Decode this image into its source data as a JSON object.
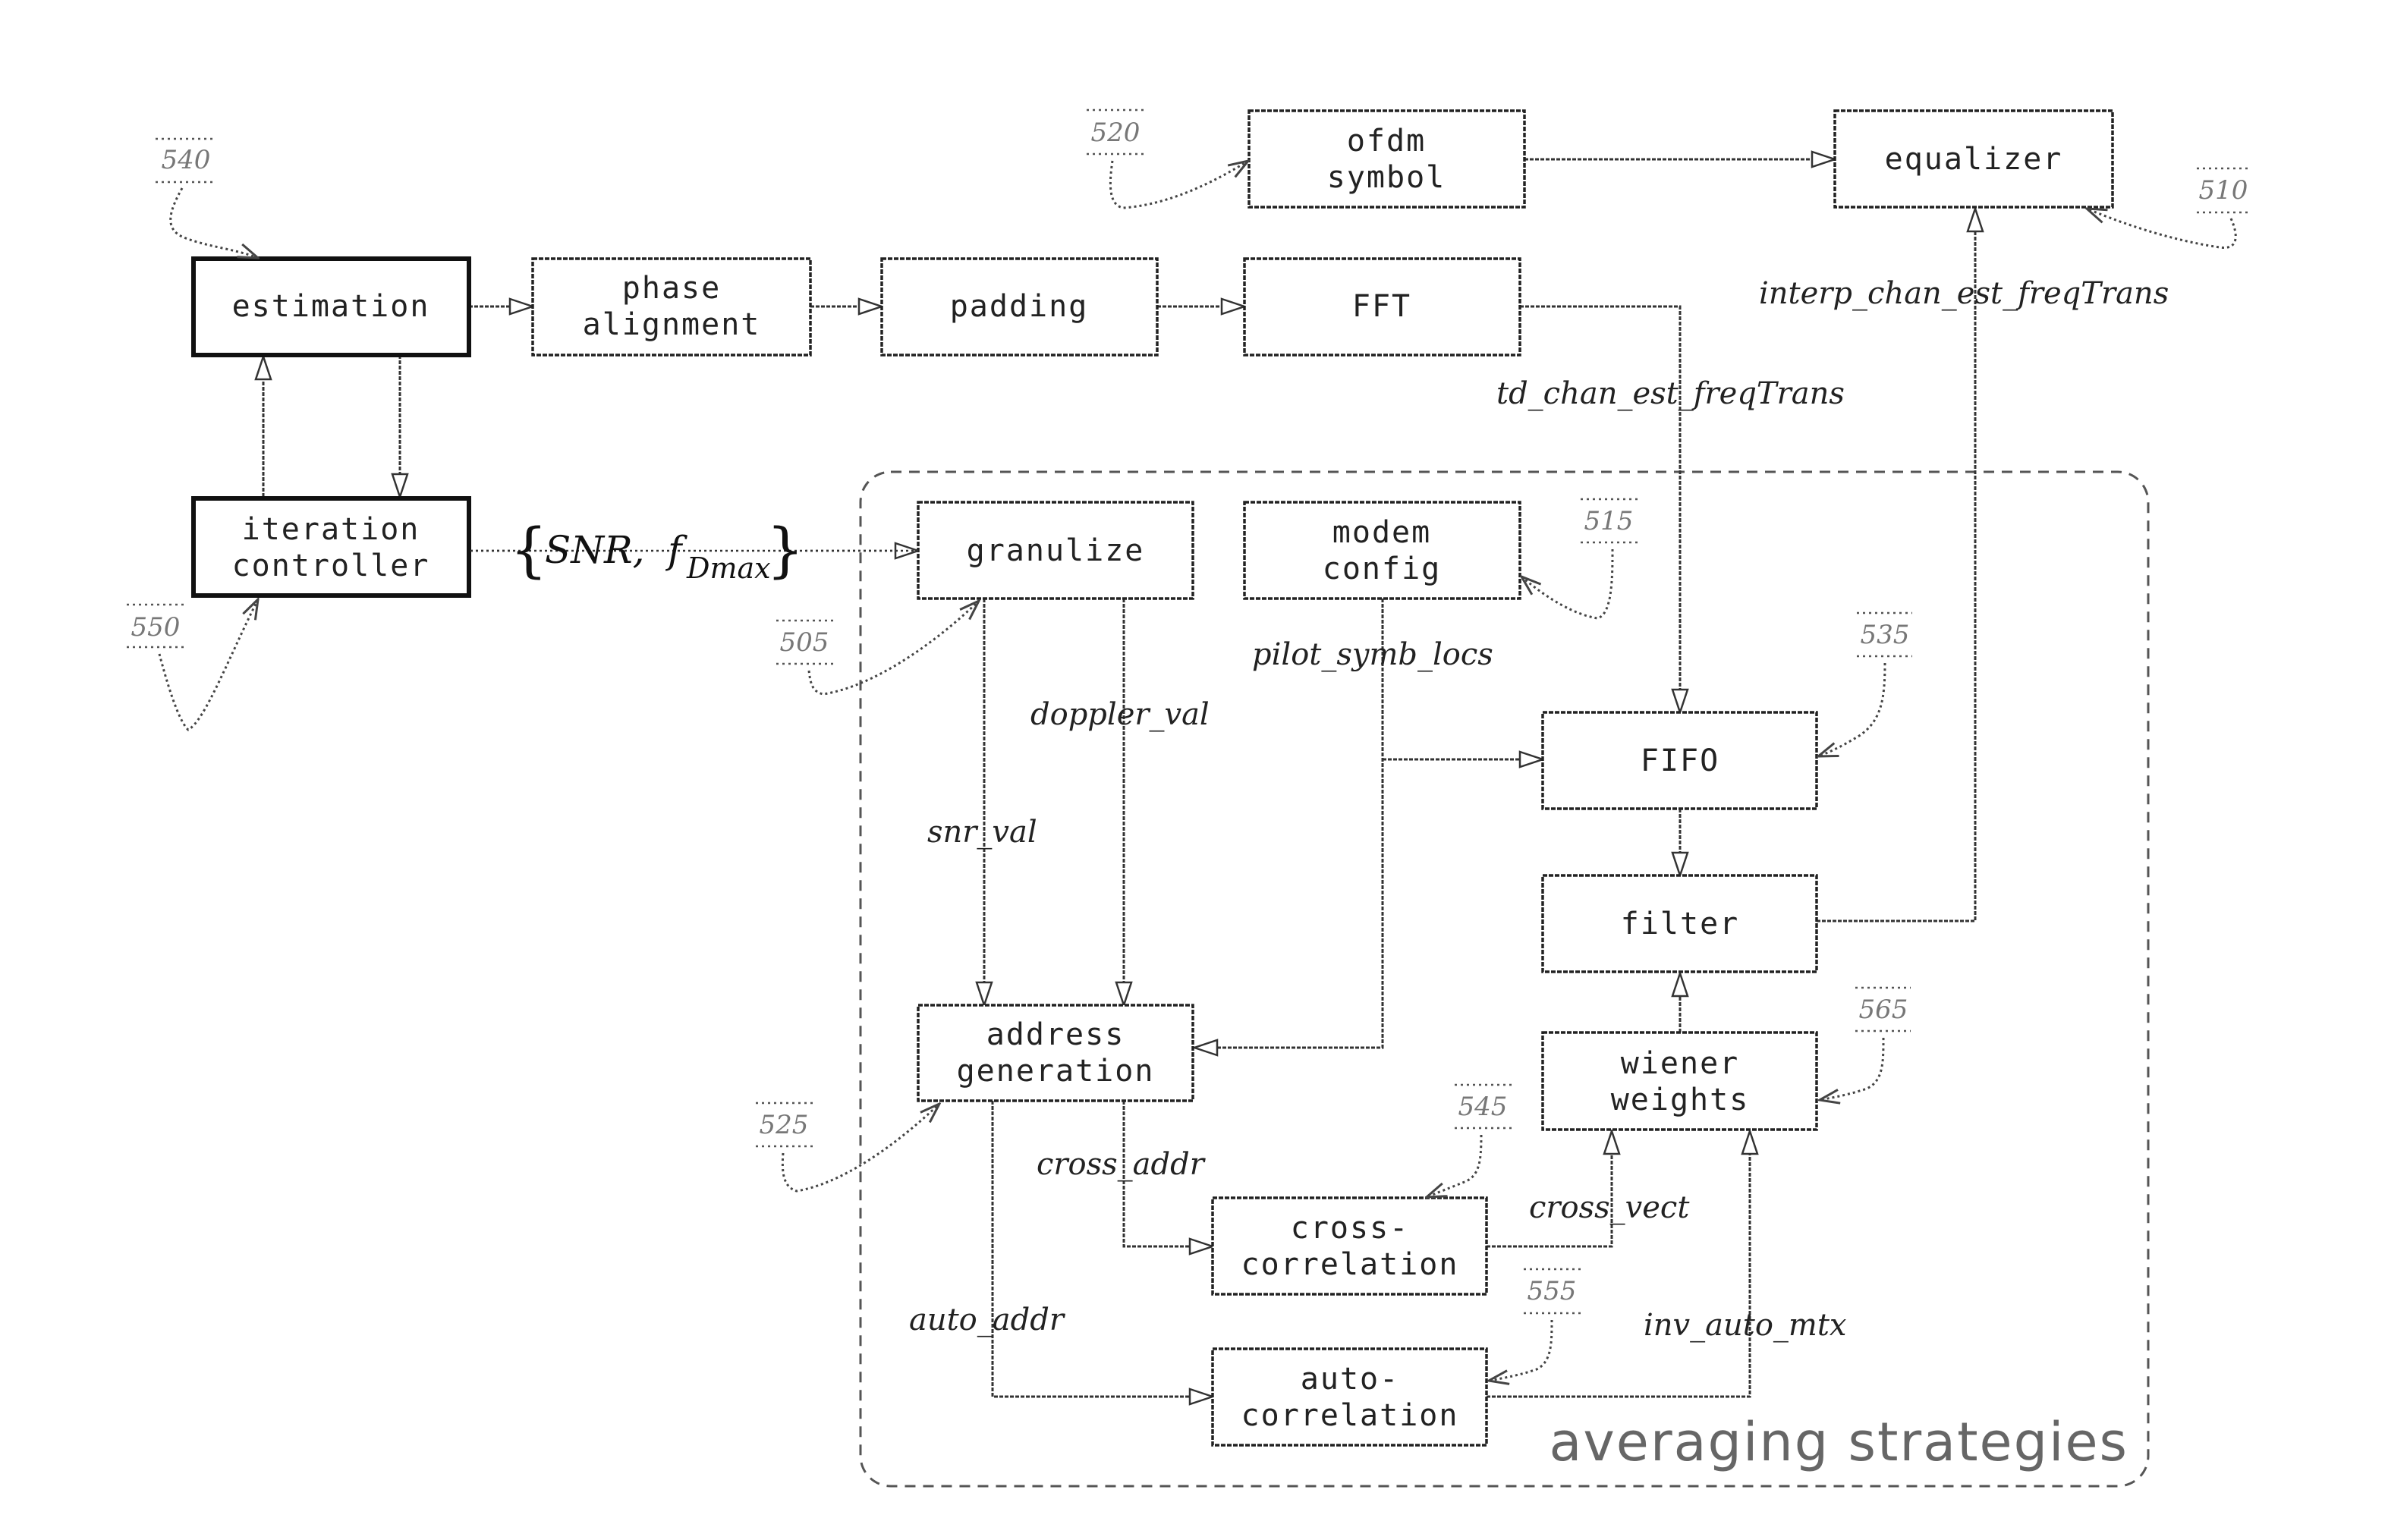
{
  "blocks": {
    "estimation": {
      "lines": [
        "estimation"
      ]
    },
    "phase_alignment": {
      "lines": [
        "phase",
        "alignment"
      ]
    },
    "padding": {
      "lines": [
        "padding"
      ]
    },
    "fft": {
      "lines": [
        "FFT"
      ]
    },
    "ofdm_symbol": {
      "lines": [
        "ofdm",
        "symbol"
      ]
    },
    "equalizer": {
      "lines": [
        "equalizer"
      ]
    },
    "iteration_controller": {
      "lines": [
        "iteration",
        "controller"
      ]
    },
    "granulize": {
      "lines": [
        "granulize"
      ]
    },
    "modem_config": {
      "lines": [
        "modem",
        "config"
      ]
    },
    "fifo": {
      "lines": [
        "FIFO"
      ]
    },
    "filter": {
      "lines": [
        "filter"
      ]
    },
    "wiener_weights": {
      "lines": [
        "wiener",
        "weights"
      ]
    },
    "address_generation": {
      "lines": [
        "address",
        "generation"
      ]
    },
    "cross_correlation": {
      "lines": [
        "cross-",
        "correlation"
      ]
    },
    "auto_correlation": {
      "lines": [
        "auto-",
        "correlation"
      ]
    }
  },
  "signals": {
    "td_chan_est_freqTrans": "td_chan_est_freqTrans",
    "interp_chan_est_freqTrans": "interp_chan_est_freqTrans",
    "pilot_symb_locs": "pilot_symb_locs",
    "doppler_val": "doppler_val",
    "snr_val": "snr_val",
    "cross_addr": "cross_addr",
    "cross_vect": "cross_vect",
    "auto_addr": "auto_addr",
    "inv_auto_mtx": "inv_auto_mtx"
  },
  "parameters": {
    "open_brace": "{",
    "snr": "SNR,",
    "f": "f",
    "f_subscript": "Dmax",
    "close_brace": "}"
  },
  "reference_numerals": {
    "r505": "505",
    "r510": "510",
    "r515": "515",
    "r520": "520",
    "r525": "525",
    "r535": "535",
    "r540": "540",
    "r545": "545",
    "r550": "550",
    "r555": "555",
    "r565": "565"
  },
  "group": {
    "label": "averaging strategies"
  }
}
